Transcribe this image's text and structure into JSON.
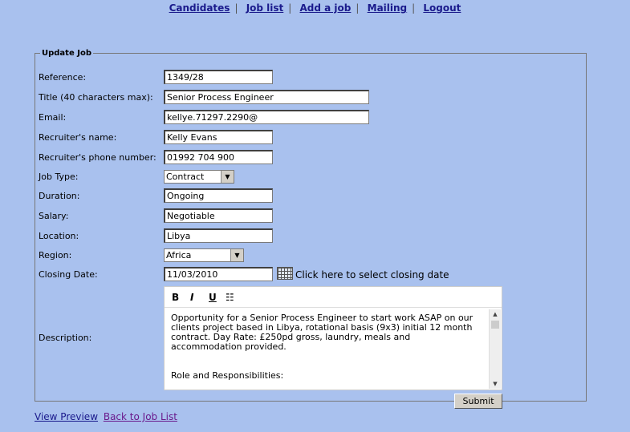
{
  "nav": [
    "Candidates",
    "Job list",
    "Add a job",
    "Mailing",
    "Logout"
  ],
  "form": {
    "legend": "Update Job",
    "labels": {
      "reference": "Reference:",
      "title": "Title (40 characters max):",
      "email": "Email:",
      "recruiter_name": "Recruiter's name:",
      "recruiter_phone": "Recruiter's phone number:",
      "job_type": "Job Type:",
      "duration": "Duration:",
      "salary": "Salary:",
      "location": "Location:",
      "region": "Region:",
      "closing_date": "Closing Date:",
      "description": "Description:"
    },
    "values": {
      "reference": "1349/28",
      "title": "Senior Process Engineer",
      "email": "kellye.71297.2290@",
      "recruiter_name": "Kelly Evans",
      "recruiter_phone": "01992 704 900",
      "job_type": "Contract",
      "duration": "Ongoing",
      "salary": "Negotiable",
      "location": "Libya",
      "region": "Africa",
      "closing_date": "11/03/2010"
    },
    "closing_date_link": "Click here to select closing date",
    "editor": {
      "bold": "B",
      "italic": "I",
      "underline": "U",
      "list": "☷",
      "text": "Opportunity for a Senior Process Engineer to start work ASAP on our clients project based in Libya, rotational basis (9x3) initial 12 month contract. Day Rate: £250pd gross, laundry, meals and accommodation provided.",
      "text2": "Role and Responsibilities:"
    },
    "submit": "Submit"
  },
  "links": {
    "preview": "View Preview",
    "back": "Back to Job List"
  }
}
